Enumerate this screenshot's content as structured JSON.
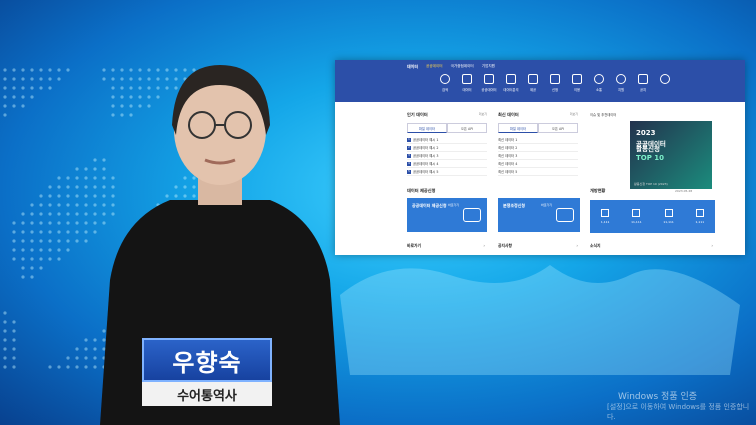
{
  "presenter": {
    "name": "우향숙",
    "role": "수어통역사"
  },
  "screen": {
    "brand": "데이터",
    "topnav": [
      "공공데이터",
      "국가중점데이터",
      "기업지원"
    ],
    "menu": [
      {
        "label": "검색",
        "icon": "search-icon"
      },
      {
        "label": "데이터",
        "icon": "folder-icon"
      },
      {
        "label": "공공데이터",
        "icon": "building-icon"
      },
      {
        "label": "데이터분석",
        "icon": "chart-icon"
      },
      {
        "label": "제공",
        "icon": "bank-icon"
      },
      {
        "label": "신청",
        "icon": "document-icon"
      },
      {
        "label": "이용",
        "icon": "grid-icon"
      },
      {
        "label": "소통",
        "icon": "people-icon"
      },
      {
        "label": "지원",
        "icon": "search-icon"
      },
      {
        "label": "공지",
        "icon": "briefcase-icon"
      },
      {
        "label": "",
        "icon": "arrow-icon"
      }
    ],
    "popular": {
      "title": "인기 데이터",
      "more": "더보기",
      "tabs": [
        "파일 데이터",
        "오픈 API"
      ],
      "rows": [
        "공공데이터 예시 1",
        "공공데이터 예시 2",
        "공공데이터 예시 3",
        "공공데이터 예시 4",
        "공공데이터 예시 5"
      ]
    },
    "latest": {
      "title": "최신 데이터",
      "more": "더보기",
      "tabs": [
        "파일 데이터",
        "오픈 API"
      ],
      "rows": [
        "최신 데이터 1",
        "최신 데이터 2",
        "최신 데이터 3",
        "최신 데이터 4",
        "최신 데이터 5"
      ]
    },
    "issue": {
      "title": "이슈 및 추천데이터",
      "banner_year": "2023",
      "banner_line1": "공공데이터",
      "banner_line2": "활용신청",
      "banner_top": "TOP 10",
      "banner_caption": "활용신청 TOP 10 (2023)"
    },
    "request": {
      "title": "데이터 제공신청",
      "box1_title": "공공데이터 제공신청",
      "box1_more": "바로가기",
      "box2_title": "분쟁조정신청",
      "box2_more": "바로가기"
    },
    "status": {
      "title": "개방현황",
      "date": "2023.05.28",
      "values": [
        "1,111",
        "11,111",
        "11,111",
        "1,111"
      ]
    },
    "bottom": [
      "바로가기",
      "공지사항",
      "소식지"
    ]
  },
  "windows": {
    "line1": "Windows 정품 인증",
    "line2": "[설정]으로 이동하여 Windows를 정품 인증합니다."
  }
}
